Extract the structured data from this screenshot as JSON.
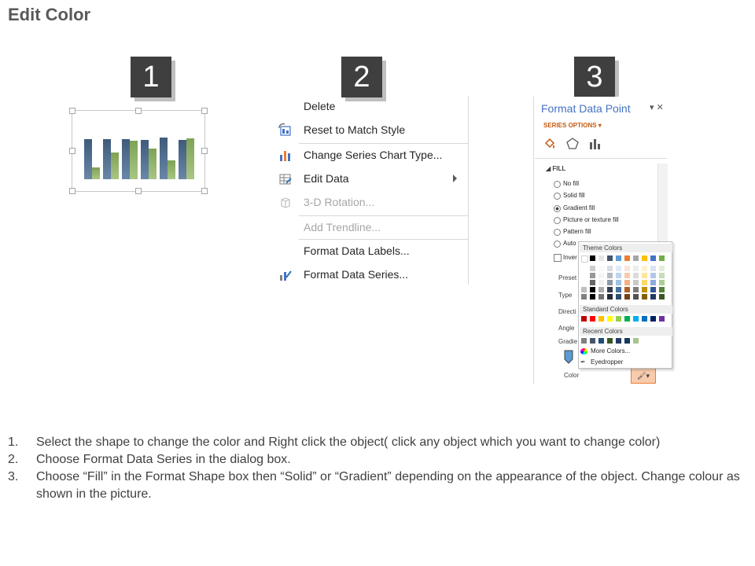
{
  "page": {
    "title": "Edit Color"
  },
  "steps": [
    "1",
    "2",
    "3"
  ],
  "chart_preview": {
    "colors": {
      "series_a": "#4a6a8e",
      "series_b": "#8bb06a"
    },
    "bars": [
      [
        0.73,
        0.22
      ],
      [
        0.73,
        0.48
      ],
      [
        0.73,
        0.7
      ],
      [
        0.72,
        0.56
      ],
      [
        0.76,
        0.34
      ],
      [
        0.72,
        0.74
      ]
    ]
  },
  "context_menu": {
    "items": [
      {
        "label": "Delete",
        "icon": "",
        "disabled": false
      },
      {
        "label": "Reset to Match Style",
        "icon": "reset-style-icon",
        "disabled": false
      },
      {
        "label": "Change Series Chart Type...",
        "icon": "chart-type-icon",
        "disabled": false
      },
      {
        "label": "Edit Data",
        "icon": "edit-data-icon",
        "disabled": false,
        "submenu": true
      },
      {
        "label": "3-D Rotation...",
        "icon": "rotation-3d-icon",
        "disabled": true
      },
      {
        "label": "Add Trendline...",
        "icon": "",
        "disabled": true
      },
      {
        "label": "Format Data Labels...",
        "icon": "",
        "disabled": false
      },
      {
        "label": "Format Data Series...",
        "icon": "format-series-icon",
        "disabled": false
      }
    ]
  },
  "format_pane": {
    "title": "Format Data Point",
    "series_options": "SERIES OPTIONS",
    "fill_heading": "FILL",
    "fill_options": [
      "No fill",
      "Solid fill",
      "Gradient fill",
      "Picture or texture fill",
      "Pattern fill",
      "Auto"
    ],
    "selected_fill": "Gradient fill",
    "invert_label": "Inver",
    "side_labels": [
      "Preset",
      "Type",
      "Directi",
      "Angle",
      "Gradie"
    ],
    "color_label": "Color",
    "picker": {
      "theme_title": "Theme Colors",
      "standard_title": "Standard Colors",
      "recent_title": "Recent Colors",
      "more_colors": "More Colors...",
      "eyedropper": "Eyedropper",
      "theme_colors": [
        "#ffffff",
        "#000000",
        "#e7e6e6",
        "#44546a",
        "#5b9bd5",
        "#ed7d31",
        "#a5a5a5",
        "#ffc000",
        "#4472c4",
        "#70ad47"
      ],
      "standard_colors": [
        "#c00000",
        "#ff0000",
        "#ffc000",
        "#ffff00",
        "#92d050",
        "#00b050",
        "#00b0f0",
        "#0070c0",
        "#002060",
        "#7030a0"
      ],
      "recent_colors": [
        "#7f7f7f",
        "#44546a",
        "#1f4e79",
        "#375623",
        "#203864",
        "#17375e",
        "#a9c48e"
      ]
    }
  },
  "instructions": [
    {
      "num": "1.",
      "text": "Select the shape to change the color and Right click the object( click any object which you want to change color)"
    },
    {
      "num": "2.",
      "text": "Choose Format Data Series in the dialog box."
    },
    {
      "num": "3.",
      "text": "Choose “Fill” in the Format Shape box then “Solid” or “Gradient” depending on the appearance of the object. Change colour as shown in the picture."
    }
  ]
}
